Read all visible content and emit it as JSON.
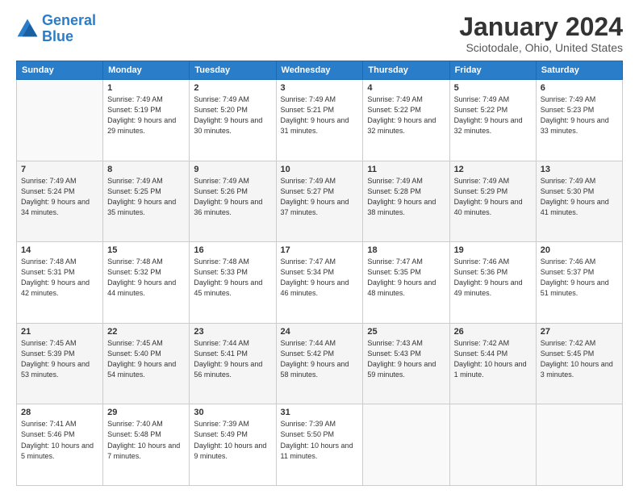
{
  "logo": {
    "line1": "General",
    "line2": "Blue"
  },
  "title": "January 2024",
  "subtitle": "Sciotodale, Ohio, United States",
  "header_days": [
    "Sunday",
    "Monday",
    "Tuesday",
    "Wednesday",
    "Thursday",
    "Friday",
    "Saturday"
  ],
  "weeks": [
    [
      {
        "day": "",
        "sunrise": "",
        "sunset": "",
        "daylight": ""
      },
      {
        "day": "1",
        "sunrise": "Sunrise: 7:49 AM",
        "sunset": "Sunset: 5:19 PM",
        "daylight": "Daylight: 9 hours and 29 minutes."
      },
      {
        "day": "2",
        "sunrise": "Sunrise: 7:49 AM",
        "sunset": "Sunset: 5:20 PM",
        "daylight": "Daylight: 9 hours and 30 minutes."
      },
      {
        "day": "3",
        "sunrise": "Sunrise: 7:49 AM",
        "sunset": "Sunset: 5:21 PM",
        "daylight": "Daylight: 9 hours and 31 minutes."
      },
      {
        "day": "4",
        "sunrise": "Sunrise: 7:49 AM",
        "sunset": "Sunset: 5:22 PM",
        "daylight": "Daylight: 9 hours and 32 minutes."
      },
      {
        "day": "5",
        "sunrise": "Sunrise: 7:49 AM",
        "sunset": "Sunset: 5:22 PM",
        "daylight": "Daylight: 9 hours and 32 minutes."
      },
      {
        "day": "6",
        "sunrise": "Sunrise: 7:49 AM",
        "sunset": "Sunset: 5:23 PM",
        "daylight": "Daylight: 9 hours and 33 minutes."
      }
    ],
    [
      {
        "day": "7",
        "sunrise": "Sunrise: 7:49 AM",
        "sunset": "Sunset: 5:24 PM",
        "daylight": "Daylight: 9 hours and 34 minutes."
      },
      {
        "day": "8",
        "sunrise": "Sunrise: 7:49 AM",
        "sunset": "Sunset: 5:25 PM",
        "daylight": "Daylight: 9 hours and 35 minutes."
      },
      {
        "day": "9",
        "sunrise": "Sunrise: 7:49 AM",
        "sunset": "Sunset: 5:26 PM",
        "daylight": "Daylight: 9 hours and 36 minutes."
      },
      {
        "day": "10",
        "sunrise": "Sunrise: 7:49 AM",
        "sunset": "Sunset: 5:27 PM",
        "daylight": "Daylight: 9 hours and 37 minutes."
      },
      {
        "day": "11",
        "sunrise": "Sunrise: 7:49 AM",
        "sunset": "Sunset: 5:28 PM",
        "daylight": "Daylight: 9 hours and 38 minutes."
      },
      {
        "day": "12",
        "sunrise": "Sunrise: 7:49 AM",
        "sunset": "Sunset: 5:29 PM",
        "daylight": "Daylight: 9 hours and 40 minutes."
      },
      {
        "day": "13",
        "sunrise": "Sunrise: 7:49 AM",
        "sunset": "Sunset: 5:30 PM",
        "daylight": "Daylight: 9 hours and 41 minutes."
      }
    ],
    [
      {
        "day": "14",
        "sunrise": "Sunrise: 7:48 AM",
        "sunset": "Sunset: 5:31 PM",
        "daylight": "Daylight: 9 hours and 42 minutes."
      },
      {
        "day": "15",
        "sunrise": "Sunrise: 7:48 AM",
        "sunset": "Sunset: 5:32 PM",
        "daylight": "Daylight: 9 hours and 44 minutes."
      },
      {
        "day": "16",
        "sunrise": "Sunrise: 7:48 AM",
        "sunset": "Sunset: 5:33 PM",
        "daylight": "Daylight: 9 hours and 45 minutes."
      },
      {
        "day": "17",
        "sunrise": "Sunrise: 7:47 AM",
        "sunset": "Sunset: 5:34 PM",
        "daylight": "Daylight: 9 hours and 46 minutes."
      },
      {
        "day": "18",
        "sunrise": "Sunrise: 7:47 AM",
        "sunset": "Sunset: 5:35 PM",
        "daylight": "Daylight: 9 hours and 48 minutes."
      },
      {
        "day": "19",
        "sunrise": "Sunrise: 7:46 AM",
        "sunset": "Sunset: 5:36 PM",
        "daylight": "Daylight: 9 hours and 49 minutes."
      },
      {
        "day": "20",
        "sunrise": "Sunrise: 7:46 AM",
        "sunset": "Sunset: 5:37 PM",
        "daylight": "Daylight: 9 hours and 51 minutes."
      }
    ],
    [
      {
        "day": "21",
        "sunrise": "Sunrise: 7:45 AM",
        "sunset": "Sunset: 5:39 PM",
        "daylight": "Daylight: 9 hours and 53 minutes."
      },
      {
        "day": "22",
        "sunrise": "Sunrise: 7:45 AM",
        "sunset": "Sunset: 5:40 PM",
        "daylight": "Daylight: 9 hours and 54 minutes."
      },
      {
        "day": "23",
        "sunrise": "Sunrise: 7:44 AM",
        "sunset": "Sunset: 5:41 PM",
        "daylight": "Daylight: 9 hours and 56 minutes."
      },
      {
        "day": "24",
        "sunrise": "Sunrise: 7:44 AM",
        "sunset": "Sunset: 5:42 PM",
        "daylight": "Daylight: 9 hours and 58 minutes."
      },
      {
        "day": "25",
        "sunrise": "Sunrise: 7:43 AM",
        "sunset": "Sunset: 5:43 PM",
        "daylight": "Daylight: 9 hours and 59 minutes."
      },
      {
        "day": "26",
        "sunrise": "Sunrise: 7:42 AM",
        "sunset": "Sunset: 5:44 PM",
        "daylight": "Daylight: 10 hours and 1 minute."
      },
      {
        "day": "27",
        "sunrise": "Sunrise: 7:42 AM",
        "sunset": "Sunset: 5:45 PM",
        "daylight": "Daylight: 10 hours and 3 minutes."
      }
    ],
    [
      {
        "day": "28",
        "sunrise": "Sunrise: 7:41 AM",
        "sunset": "Sunset: 5:46 PM",
        "daylight": "Daylight: 10 hours and 5 minutes."
      },
      {
        "day": "29",
        "sunrise": "Sunrise: 7:40 AM",
        "sunset": "Sunset: 5:48 PM",
        "daylight": "Daylight: 10 hours and 7 minutes."
      },
      {
        "day": "30",
        "sunrise": "Sunrise: 7:39 AM",
        "sunset": "Sunset: 5:49 PM",
        "daylight": "Daylight: 10 hours and 9 minutes."
      },
      {
        "day": "31",
        "sunrise": "Sunrise: 7:39 AM",
        "sunset": "Sunset: 5:50 PM",
        "daylight": "Daylight: 10 hours and 11 minutes."
      },
      {
        "day": "",
        "sunrise": "",
        "sunset": "",
        "daylight": ""
      },
      {
        "day": "",
        "sunrise": "",
        "sunset": "",
        "daylight": ""
      },
      {
        "day": "",
        "sunrise": "",
        "sunset": "",
        "daylight": ""
      }
    ]
  ]
}
